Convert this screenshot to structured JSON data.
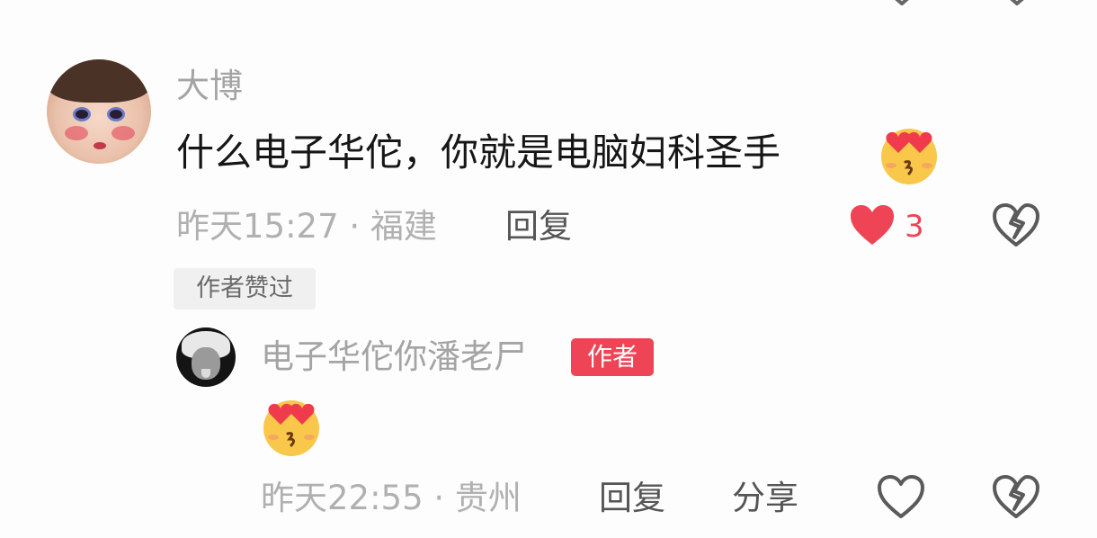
{
  "comment": {
    "username": "大博",
    "text": "什么电子华佗，你就是电脑妇科圣手",
    "emoji": "heart-eyes-kissing-emoji",
    "time_location": "昨天15:27 · 福建",
    "reply_label": "回复",
    "like_count": "3",
    "liked_by_author_tag": "作者赞过"
  },
  "reply": {
    "username": "电子华佗你潘老尸",
    "author_badge": "作者",
    "emoji": "heart-eyes-kissing-emoji",
    "time_location": "昨天22:55 · 贵州",
    "reply_label": "回复",
    "share_label": "分享"
  },
  "colors": {
    "accent": "#ef4456",
    "muted_text": "#b0b0b0",
    "primary_text": "#161616"
  }
}
